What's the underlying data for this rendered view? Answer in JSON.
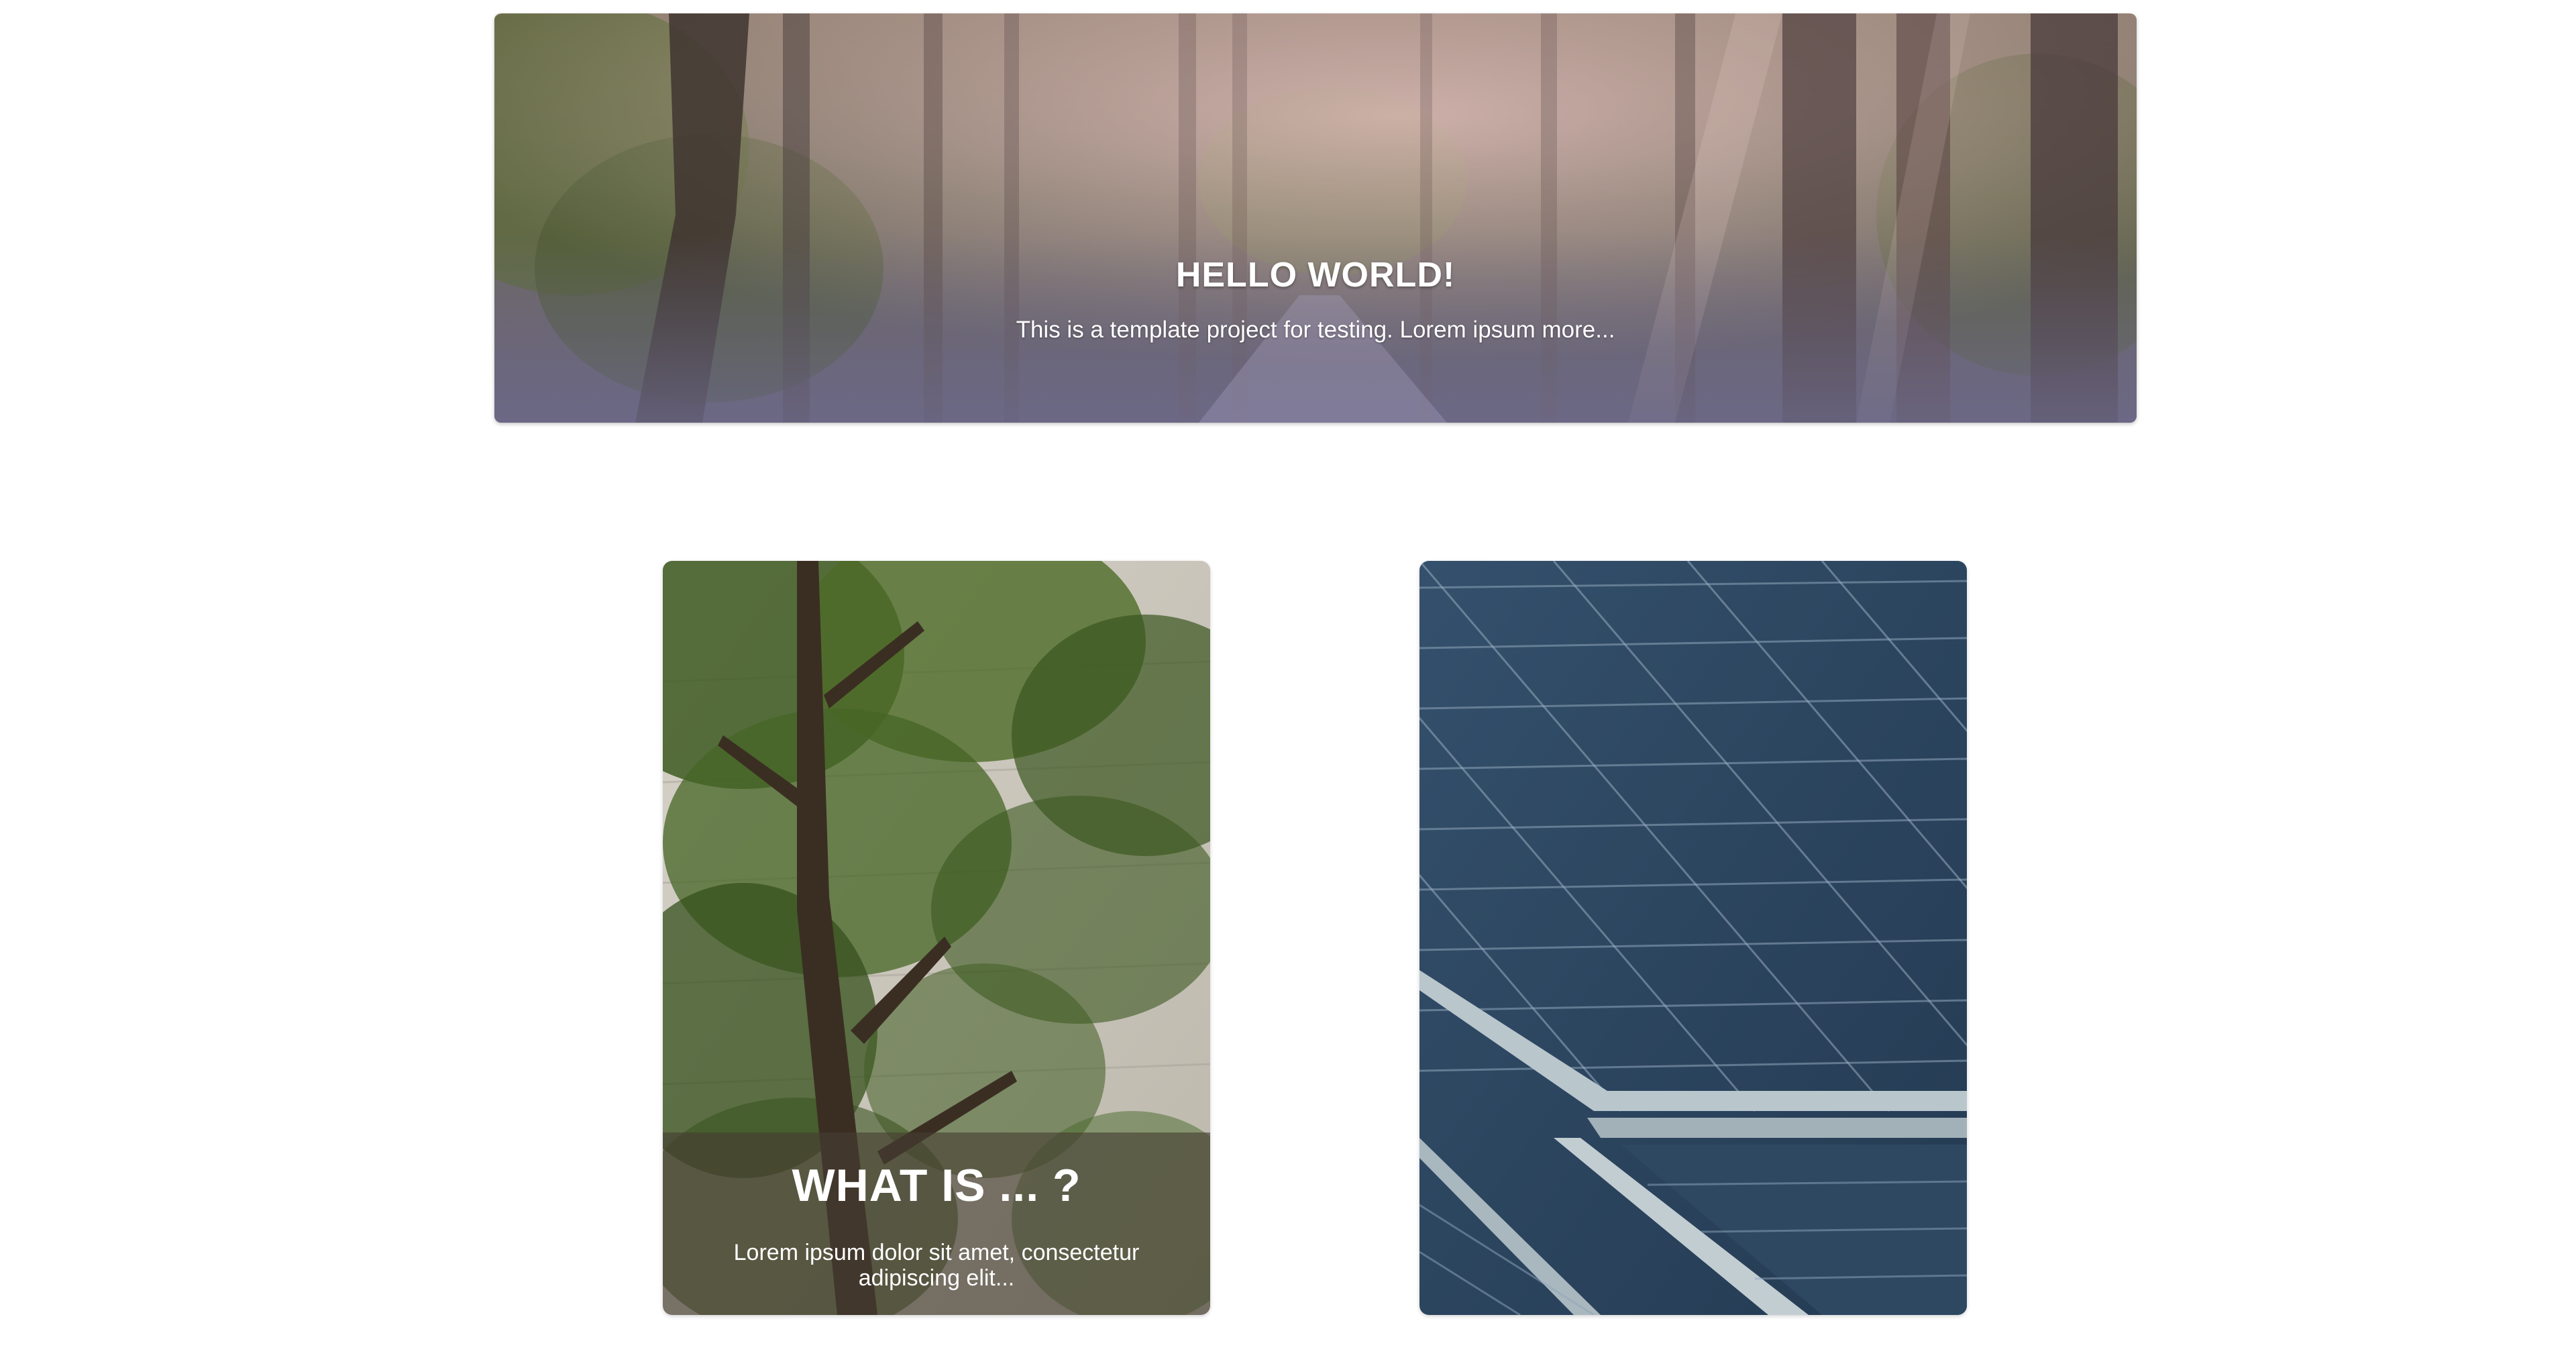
{
  "hero": {
    "title": "HELLO WORLD!",
    "subtitle": "This is a template project for testing. Lorem ipsum more..."
  },
  "cards": [
    {
      "image": "forest-tree-photo",
      "title": "WHAT IS ... ?",
      "description": "Lorem ipsum dolor sit amet, consectetur adipiscing elit..."
    },
    {
      "image": "solar-panels-photo"
    }
  ],
  "colors": {
    "hero_overlay": "#b08a9a",
    "caption_overlay": "#463e32",
    "solar_blue": "#2c4460",
    "panel_frame": "#9aa7ae"
  }
}
